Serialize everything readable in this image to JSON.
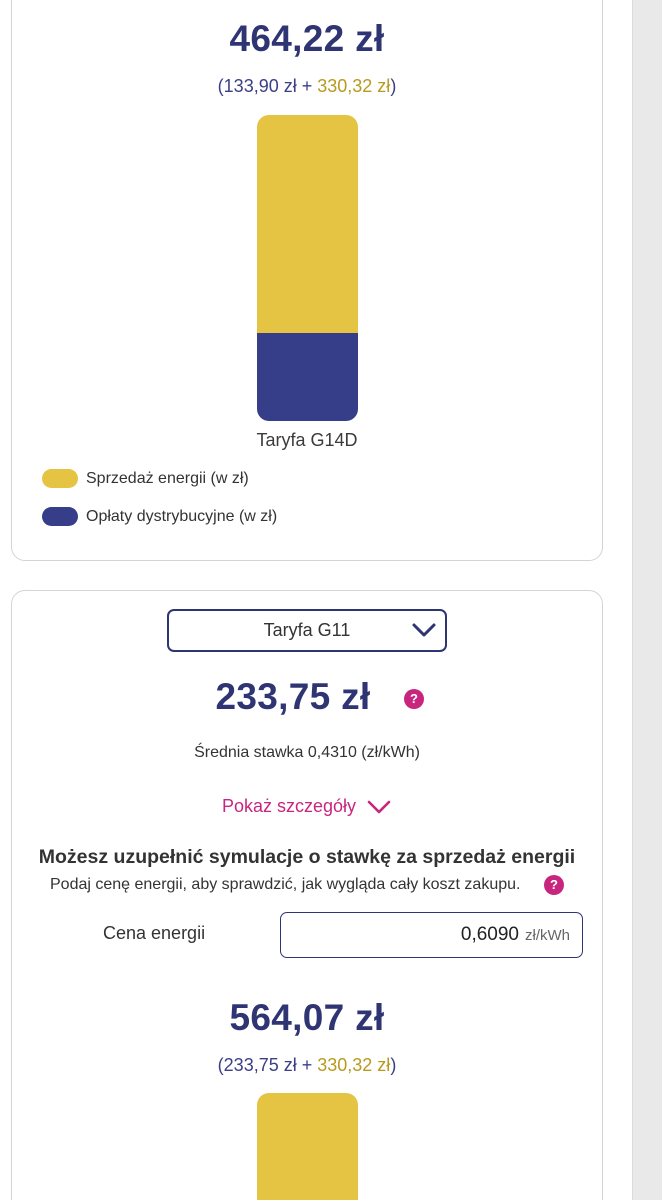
{
  "card1": {
    "total": "464,22 zł",
    "breakdown_open": "(",
    "breakdown_dist": "133,90 zł",
    "breakdown_plus": " + ",
    "breakdown_sales": "330,32 zł",
    "breakdown_close": ")",
    "bar_label": "Taryfa G14D",
    "bar_sales_fraction": 0.711,
    "bar_dist_fraction": 0.289
  },
  "legend": {
    "sales": "Sprzedaż energii (w zł)",
    "distribution": "Opłaty dystrybucyjne (w zł)"
  },
  "card2": {
    "tariff_selected": "Taryfa G11",
    "total": "233,75 zł",
    "help_glyph": "?",
    "avg_rate": "Średnia stawka 0,4310 (zł/kWh)",
    "details_link": "Pokaż szczegóły",
    "sim_title": "Możesz uzupełnić symulacje o stawkę za sprzedaż energii",
    "sim_sub": "Podaj cenę energii, aby sprawdzić, jak wygląda cały koszt zakupu.",
    "price_label": "Cena energii",
    "price_value": "0,6090",
    "price_unit": "zł/kWh",
    "total_with_energy": "564,07 zł",
    "breakdown_open": "(",
    "breakdown_dist": "233,75 zł",
    "breakdown_plus": " + ",
    "breakdown_sales": "330,32 zł",
    "breakdown_close": ")"
  },
  "colors": {
    "sales": "#e5c444",
    "distribution": "#363e8a",
    "accent": "#c8267e",
    "navy": "#2f3573"
  },
  "icons": {
    "help": "question-circle-icon",
    "chevron": "chevron-down-icon"
  }
}
